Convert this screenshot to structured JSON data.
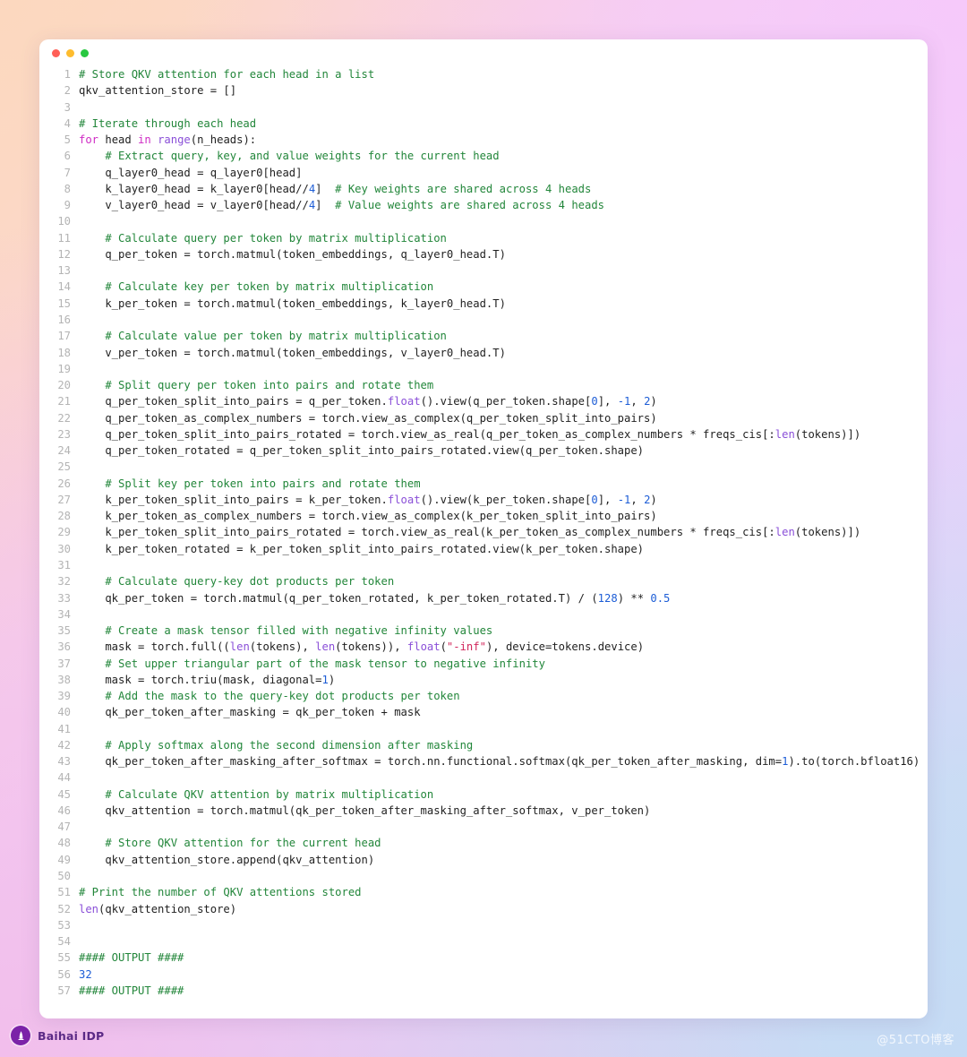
{
  "window": {
    "traffic_lights": [
      {
        "name": "close-dot",
        "color": "#ff5f57"
      },
      {
        "name": "minimize-dot",
        "color": "#febc2e"
      },
      {
        "name": "maximize-dot",
        "color": "#28c840"
      }
    ]
  },
  "editor": {
    "language": "python",
    "theme_colors": {
      "background": "#ffffff",
      "text": "#1f1f1f",
      "line_number": "#b4b4b4",
      "comment": "#22863a",
      "keyword": "#cf2bc4",
      "builtin": "#8a4fd8",
      "number": "#1d5dd6",
      "string": "#d1265b"
    },
    "lines": [
      {
        "n": "1",
        "tokens": [
          {
            "t": "# Store QKV attention for each head in a list",
            "c": "c"
          }
        ]
      },
      {
        "n": "2",
        "tokens": [
          {
            "t": "qkv_attention_store = []",
            "c": ""
          }
        ]
      },
      {
        "n": "3",
        "tokens": [
          {
            "t": "",
            "c": ""
          }
        ]
      },
      {
        "n": "4",
        "tokens": [
          {
            "t": "# Iterate through each head",
            "c": "c"
          }
        ]
      },
      {
        "n": "5",
        "tokens": [
          {
            "t": "for",
            "c": "k"
          },
          {
            "t": " head ",
            "c": ""
          },
          {
            "t": "in",
            "c": "k"
          },
          {
            "t": " ",
            "c": ""
          },
          {
            "t": "range",
            "c": "bi"
          },
          {
            "t": "(n_heads):",
            "c": ""
          }
        ]
      },
      {
        "n": "6",
        "tokens": [
          {
            "t": "    # Extract query, key, and value weights for the current head",
            "c": "c"
          }
        ]
      },
      {
        "n": "7",
        "tokens": [
          {
            "t": "    q_layer0_head = q_layer0[head]",
            "c": ""
          }
        ]
      },
      {
        "n": "8",
        "tokens": [
          {
            "t": "    k_layer0_head = k_layer0[head//",
            "c": ""
          },
          {
            "t": "4",
            "c": "n"
          },
          {
            "t": "]  ",
            "c": ""
          },
          {
            "t": "# Key weights are shared across 4 heads",
            "c": "c"
          }
        ]
      },
      {
        "n": "9",
        "tokens": [
          {
            "t": "    v_layer0_head = v_layer0[head//",
            "c": ""
          },
          {
            "t": "4",
            "c": "n"
          },
          {
            "t": "]  ",
            "c": ""
          },
          {
            "t": "# Value weights are shared across 4 heads",
            "c": "c"
          }
        ]
      },
      {
        "n": "10",
        "tokens": [
          {
            "t": "",
            "c": ""
          }
        ]
      },
      {
        "n": "11",
        "tokens": [
          {
            "t": "    # Calculate query per token by matrix multiplication",
            "c": "c"
          }
        ]
      },
      {
        "n": "12",
        "tokens": [
          {
            "t": "    q_per_token = torch.matmul(token_embeddings, q_layer0_head.T)",
            "c": ""
          }
        ]
      },
      {
        "n": "13",
        "tokens": [
          {
            "t": "",
            "c": ""
          }
        ]
      },
      {
        "n": "14",
        "tokens": [
          {
            "t": "    # Calculate key per token by matrix multiplication",
            "c": "c"
          }
        ]
      },
      {
        "n": "15",
        "tokens": [
          {
            "t": "    k_per_token = torch.matmul(token_embeddings, k_layer0_head.T)",
            "c": ""
          }
        ]
      },
      {
        "n": "16",
        "tokens": [
          {
            "t": "",
            "c": ""
          }
        ]
      },
      {
        "n": "17",
        "tokens": [
          {
            "t": "    # Calculate value per token by matrix multiplication",
            "c": "c"
          }
        ]
      },
      {
        "n": "18",
        "tokens": [
          {
            "t": "    v_per_token = torch.matmul(token_embeddings, v_layer0_head.T)",
            "c": ""
          }
        ]
      },
      {
        "n": "19",
        "tokens": [
          {
            "t": "",
            "c": ""
          }
        ]
      },
      {
        "n": "20",
        "tokens": [
          {
            "t": "    # Split query per token into pairs and rotate them",
            "c": "c"
          }
        ]
      },
      {
        "n": "21",
        "tokens": [
          {
            "t": "    q_per_token_split_into_pairs = q_per_token.",
            "c": ""
          },
          {
            "t": "float",
            "c": "bi"
          },
          {
            "t": "().view(q_per_token.shape[",
            "c": ""
          },
          {
            "t": "0",
            "c": "n"
          },
          {
            "t": "], ",
            "c": ""
          },
          {
            "t": "-1",
            "c": "n"
          },
          {
            "t": ", ",
            "c": ""
          },
          {
            "t": "2",
            "c": "n"
          },
          {
            "t": ")",
            "c": ""
          }
        ]
      },
      {
        "n": "22",
        "tokens": [
          {
            "t": "    q_per_token_as_complex_numbers = torch.view_as_complex(q_per_token_split_into_pairs)",
            "c": ""
          }
        ]
      },
      {
        "n": "23",
        "tokens": [
          {
            "t": "    q_per_token_split_into_pairs_rotated = torch.view_as_real(q_per_token_as_complex_numbers * freqs_cis[:",
            "c": ""
          },
          {
            "t": "len",
            "c": "bi"
          },
          {
            "t": "(tokens)])",
            "c": ""
          }
        ]
      },
      {
        "n": "24",
        "tokens": [
          {
            "t": "    q_per_token_rotated = q_per_token_split_into_pairs_rotated.view(q_per_token.shape)",
            "c": ""
          }
        ]
      },
      {
        "n": "25",
        "tokens": [
          {
            "t": "",
            "c": ""
          }
        ]
      },
      {
        "n": "26",
        "tokens": [
          {
            "t": "    # Split key per token into pairs and rotate them",
            "c": "c"
          }
        ]
      },
      {
        "n": "27",
        "tokens": [
          {
            "t": "    k_per_token_split_into_pairs = k_per_token.",
            "c": ""
          },
          {
            "t": "float",
            "c": "bi"
          },
          {
            "t": "().view(k_per_token.shape[",
            "c": ""
          },
          {
            "t": "0",
            "c": "n"
          },
          {
            "t": "], ",
            "c": ""
          },
          {
            "t": "-1",
            "c": "n"
          },
          {
            "t": ", ",
            "c": ""
          },
          {
            "t": "2",
            "c": "n"
          },
          {
            "t": ")",
            "c": ""
          }
        ]
      },
      {
        "n": "28",
        "tokens": [
          {
            "t": "    k_per_token_as_complex_numbers = torch.view_as_complex(k_per_token_split_into_pairs)",
            "c": ""
          }
        ]
      },
      {
        "n": "29",
        "tokens": [
          {
            "t": "    k_per_token_split_into_pairs_rotated = torch.view_as_real(k_per_token_as_complex_numbers * freqs_cis[:",
            "c": ""
          },
          {
            "t": "len",
            "c": "bi"
          },
          {
            "t": "(tokens)])",
            "c": ""
          }
        ]
      },
      {
        "n": "30",
        "tokens": [
          {
            "t": "    k_per_token_rotated = k_per_token_split_into_pairs_rotated.view(k_per_token.shape)",
            "c": ""
          }
        ]
      },
      {
        "n": "31",
        "tokens": [
          {
            "t": "",
            "c": ""
          }
        ]
      },
      {
        "n": "32",
        "tokens": [
          {
            "t": "    # Calculate query-key dot products per token",
            "c": "c"
          }
        ]
      },
      {
        "n": "33",
        "tokens": [
          {
            "t": "    qk_per_token = torch.matmul(q_per_token_rotated, k_per_token_rotated.T) / (",
            "c": ""
          },
          {
            "t": "128",
            "c": "n"
          },
          {
            "t": ") ** ",
            "c": ""
          },
          {
            "t": "0.5",
            "c": "n"
          }
        ]
      },
      {
        "n": "34",
        "tokens": [
          {
            "t": "",
            "c": ""
          }
        ]
      },
      {
        "n": "35",
        "tokens": [
          {
            "t": "    # Create a mask tensor filled with negative infinity values",
            "c": "c"
          }
        ]
      },
      {
        "n": "36",
        "tokens": [
          {
            "t": "    mask = torch.full((",
            "c": ""
          },
          {
            "t": "len",
            "c": "bi"
          },
          {
            "t": "(tokens), ",
            "c": ""
          },
          {
            "t": "len",
            "c": "bi"
          },
          {
            "t": "(tokens)), ",
            "c": ""
          },
          {
            "t": "float",
            "c": "bi"
          },
          {
            "t": "(",
            "c": ""
          },
          {
            "t": "\"-inf\"",
            "c": "s"
          },
          {
            "t": "), device=tokens.device)",
            "c": ""
          }
        ]
      },
      {
        "n": "37",
        "tokens": [
          {
            "t": "    # Set upper triangular part of the mask tensor to negative infinity",
            "c": "c"
          }
        ]
      },
      {
        "n": "38",
        "tokens": [
          {
            "t": "    mask = torch.triu(mask, diagonal=",
            "c": ""
          },
          {
            "t": "1",
            "c": "n"
          },
          {
            "t": ")",
            "c": ""
          }
        ]
      },
      {
        "n": "39",
        "tokens": [
          {
            "t": "    # Add the mask to the query-key dot products per token",
            "c": "c"
          }
        ]
      },
      {
        "n": "40",
        "tokens": [
          {
            "t": "    qk_per_token_after_masking = qk_per_token + mask",
            "c": ""
          }
        ]
      },
      {
        "n": "41",
        "tokens": [
          {
            "t": "",
            "c": ""
          }
        ]
      },
      {
        "n": "42",
        "tokens": [
          {
            "t": "    # Apply softmax along the second dimension after masking",
            "c": "c"
          }
        ]
      },
      {
        "n": "43",
        "tokens": [
          {
            "t": "    qk_per_token_after_masking_after_softmax = torch.nn.functional.softmax(qk_per_token_after_masking, dim=",
            "c": ""
          },
          {
            "t": "1",
            "c": "n"
          },
          {
            "t": ").to(torch.bfloat16)",
            "c": ""
          }
        ]
      },
      {
        "n": "44",
        "tokens": [
          {
            "t": "",
            "c": ""
          }
        ]
      },
      {
        "n": "45",
        "tokens": [
          {
            "t": "    # Calculate QKV attention by matrix multiplication",
            "c": "c"
          }
        ]
      },
      {
        "n": "46",
        "tokens": [
          {
            "t": "    qkv_attention = torch.matmul(qk_per_token_after_masking_after_softmax, v_per_token)",
            "c": ""
          }
        ]
      },
      {
        "n": "47",
        "tokens": [
          {
            "t": "",
            "c": ""
          }
        ]
      },
      {
        "n": "48",
        "tokens": [
          {
            "t": "    # Store QKV attention for the current head",
            "c": "c"
          }
        ]
      },
      {
        "n": "49",
        "tokens": [
          {
            "t": "    qkv_attention_store.append(qkv_attention)",
            "c": ""
          }
        ]
      },
      {
        "n": "50",
        "tokens": [
          {
            "t": "",
            "c": ""
          }
        ]
      },
      {
        "n": "51",
        "tokens": [
          {
            "t": "# Print the number of QKV attentions stored",
            "c": "c"
          }
        ]
      },
      {
        "n": "52",
        "tokens": [
          {
            "t": "len",
            "c": "bi"
          },
          {
            "t": "(qkv_attention_store)",
            "c": ""
          }
        ]
      },
      {
        "n": "53",
        "tokens": [
          {
            "t": "",
            "c": ""
          }
        ]
      },
      {
        "n": "54",
        "tokens": [
          {
            "t": "",
            "c": ""
          }
        ]
      },
      {
        "n": "55",
        "tokens": [
          {
            "t": "#### OUTPUT ####",
            "c": "c"
          }
        ]
      },
      {
        "n": "56",
        "tokens": [
          {
            "t": "32",
            "c": "n"
          }
        ]
      },
      {
        "n": "57",
        "tokens": [
          {
            "t": "#### OUTPUT ####",
            "c": "c"
          }
        ]
      }
    ]
  },
  "footer": {
    "brand_name": "Baihai IDP",
    "brand_icon": "baihai-logo-icon",
    "watermark": "@51CTO博客"
  }
}
